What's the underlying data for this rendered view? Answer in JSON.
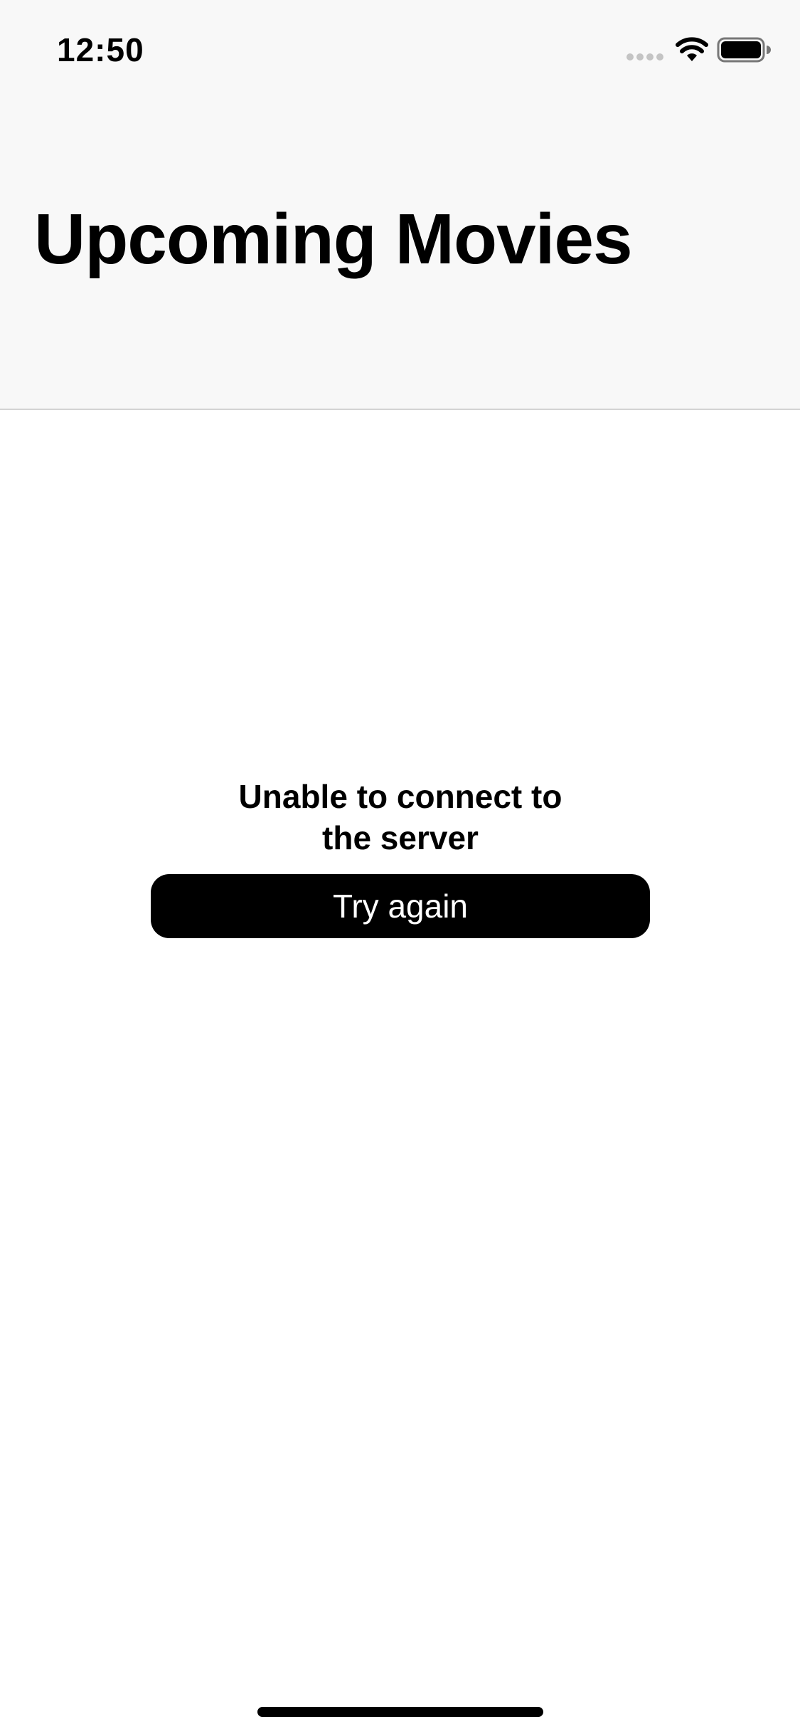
{
  "status_bar": {
    "time": "12:50",
    "icons": [
      "cellular-signal-icon",
      "wifi-icon",
      "battery-icon"
    ]
  },
  "nav": {
    "title": "Upcoming Movies"
  },
  "error_state": {
    "message": "Unable to connect to the server",
    "retry_label": "Try again"
  },
  "colors": {
    "nav_background": "#f8f8f8",
    "separator": "#d4d4d4",
    "button_background": "#000000",
    "button_text": "#ffffff",
    "text": "#000000"
  }
}
